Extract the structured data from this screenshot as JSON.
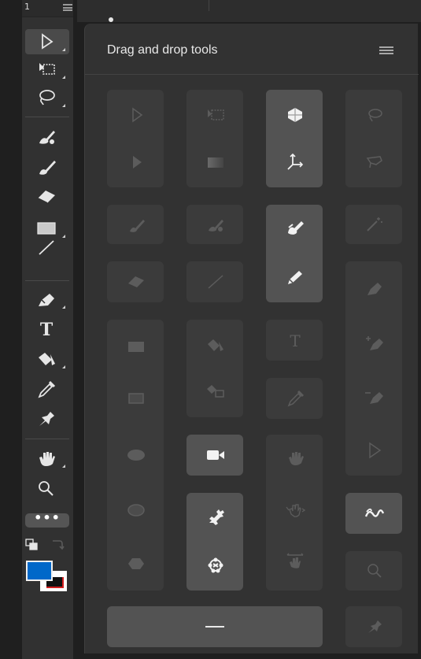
{
  "toolbar": {
    "workspace_number": "1",
    "more_tools_label": "•••"
  },
  "panel": {
    "title": "Drag and drop tools"
  },
  "colors": {
    "foreground": "#0068c9",
    "background": "#ffffff",
    "panel_bg": "#323232",
    "group_bg": "#3b3b3b",
    "group_active_bg": "#535353"
  },
  "toolbar_tools": [
    "move-tool",
    "artboard-tool",
    "lasso-tool",
    "healing-brush-tool",
    "brush-tool",
    "eraser-tool",
    "rectangle-tool",
    "line-tool",
    "pen-tool",
    "type-tool",
    "paint-bucket-tool",
    "eyedropper-tool",
    "pin-tool",
    "hand-tool",
    "zoom-tool"
  ]
}
